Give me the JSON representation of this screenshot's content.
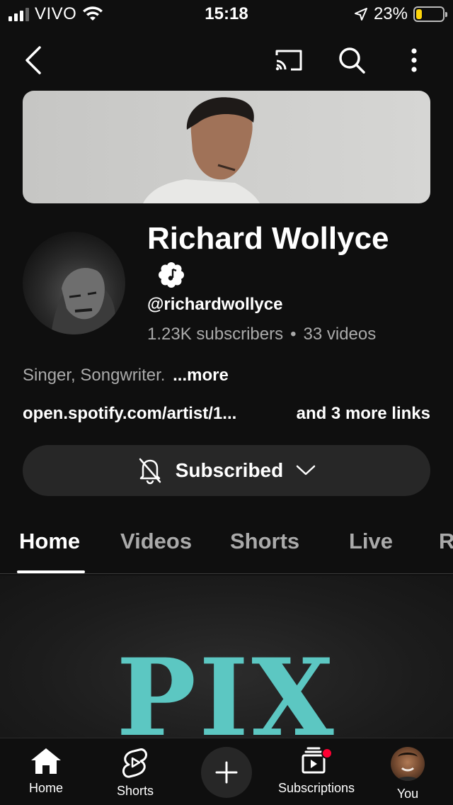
{
  "status_bar": {
    "carrier": "VIVO",
    "time": "15:18",
    "battery_percent": "23%",
    "battery_level": 0.23,
    "icons": [
      "signal-icon",
      "wifi-icon",
      "location-arrow-icon",
      "battery-icon"
    ]
  },
  "app_bar": {
    "icons": [
      "back-icon",
      "cast-icon",
      "search-icon",
      "more-vert-icon"
    ]
  },
  "channel": {
    "name": "Richard Wollyce",
    "handle": "@richardwollyce",
    "subscribers": "1.23K subscribers",
    "separator": "•",
    "videos": "33 videos",
    "description": "Singer, Songwriter.",
    "more_label": "...more",
    "link_primary": "open.spotify.com/artist/1...",
    "link_more": "and 3 more links",
    "subscribe_label": "Subscribed"
  },
  "tabs": [
    {
      "label": "Home",
      "active": true
    },
    {
      "label": "Videos",
      "active": false
    },
    {
      "label": "Shorts",
      "active": false
    },
    {
      "label": "Live",
      "active": false
    },
    {
      "label": "R",
      "active": false
    }
  ],
  "featured": {
    "title_text": "PIX"
  },
  "bottom_nav": [
    {
      "label": "Home",
      "icon": "home-icon"
    },
    {
      "label": "Shorts",
      "icon": "shorts-icon"
    },
    {
      "label": "",
      "icon": "create-icon"
    },
    {
      "label": "Subscriptions",
      "icon": "subscriptions-icon"
    },
    {
      "label": "You",
      "icon": "avatar"
    }
  ],
  "colors": {
    "background": "#0f0f0f",
    "surface": "#272727",
    "secondary_text": "#aaaaaa",
    "battery": "#ffd60a",
    "notification_dot": "#ff0033",
    "featured_text": "#5cc7c2"
  }
}
